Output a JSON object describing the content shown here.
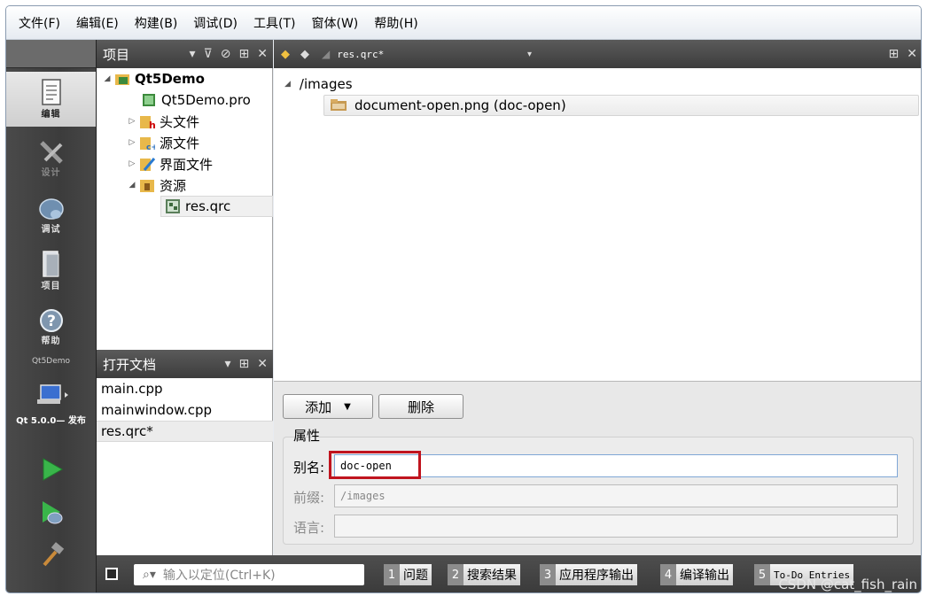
{
  "menubar": [
    "文件(F)",
    "编辑(E)",
    "构建(B)",
    "调试(D)",
    "工具(T)",
    "窗体(W)",
    "帮助(H)"
  ],
  "modes": [
    {
      "label": "编辑",
      "icon": "edit-document-icon",
      "active": true
    },
    {
      "label": "设计",
      "icon": "design-tools-icon",
      "disabled": true
    },
    {
      "label": "调试",
      "icon": "debug-bug-icon"
    },
    {
      "label": "项目",
      "icon": "project-book-icon"
    },
    {
      "label": "帮助",
      "icon": "help-question-icon"
    }
  ],
  "target": {
    "name": "Qt5Demo",
    "kit_label": "Qt 5.0.0— 发布"
  },
  "project_pane": {
    "title": "项目",
    "tree": [
      {
        "label": "Qt5Demo",
        "arrow": "◢",
        "icon": "project-folder-icon",
        "bold": true
      },
      {
        "label": "Qt5Demo.pro",
        "arrow": "",
        "icon": "pro-file-icon"
      },
      {
        "label": "头文件",
        "arrow": "▷",
        "icon": "headers-folder-icon"
      },
      {
        "label": "源文件",
        "arrow": "▷",
        "icon": "sources-folder-icon"
      },
      {
        "label": "界面文件",
        "arrow": "▷",
        "icon": "forms-folder-icon"
      },
      {
        "label": "资源",
        "arrow": "◢",
        "icon": "resources-folder-icon"
      },
      {
        "label": "res.qrc",
        "arrow": "",
        "icon": "qrc-file-icon",
        "selected": true
      }
    ]
  },
  "open_docs": {
    "title": "打开文档",
    "items": [
      {
        "label": "main.cpp"
      },
      {
        "label": "mainwindow.cpp"
      },
      {
        "label": "res.qrc*",
        "selected": true
      }
    ]
  },
  "editor": {
    "file_name": "res.qrc*",
    "resource_tree": {
      "prefix": "/images",
      "file": "document-open.png (doc-open)"
    },
    "add_button": "添加",
    "delete_button": "删除",
    "properties_title": "属性",
    "alias_label": "别名:",
    "alias_value": "doc-open",
    "prefix_label": "前缀:",
    "prefix_value": "/images",
    "language_label": "语言:",
    "language_value": ""
  },
  "statusbar": {
    "locator_placeholder": "输入以定位(Ctrl+K)",
    "tabs": [
      {
        "num": "1",
        "label": "问题"
      },
      {
        "num": "2",
        "label": "搜索结果"
      },
      {
        "num": "3",
        "label": "应用程序输出"
      },
      {
        "num": "4",
        "label": "编译输出"
      },
      {
        "num": "5",
        "label": "To-Do Entries"
      }
    ],
    "watermark": "CSDN @cat_fish_rain"
  }
}
